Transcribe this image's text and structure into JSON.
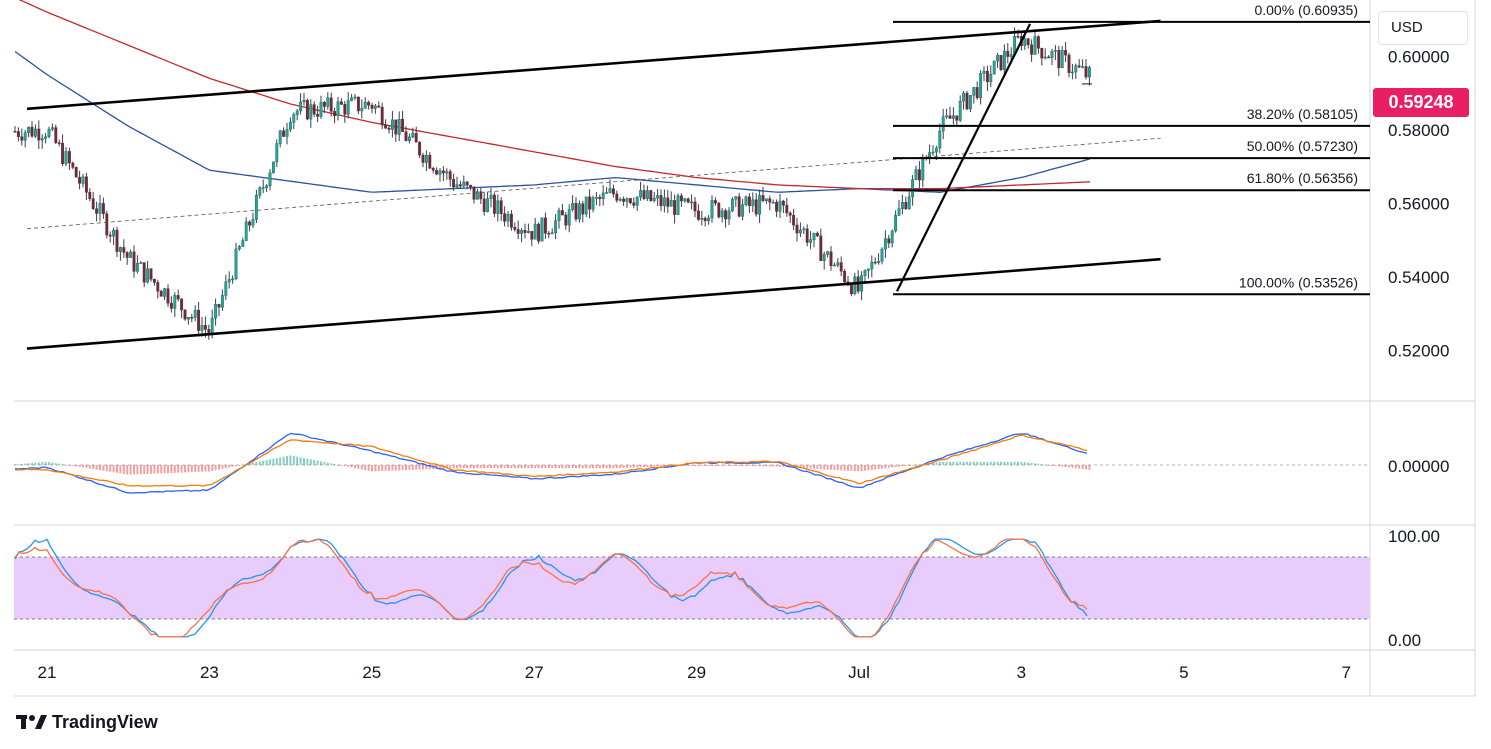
{
  "currency": "USD",
  "last_price": "0.59248",
  "colors": {
    "up": "#26a69a",
    "down": "#ef5350",
    "candle_body": "#6b2c3a",
    "ma_fast": "#2952a3",
    "ma_slow": "#c62828",
    "macd": "#2962ff",
    "signal": "#f57c00",
    "stoch_k": "#2196f3",
    "stoch_d": "#ff7043",
    "stoch_band": "#e8ccfb",
    "last_price": "#e91e63"
  },
  "chart_data": [
    {
      "type": "candlestick",
      "panel": "price",
      "ylim": [
        0.5065,
        0.6153
      ],
      "x_ticks": [
        "21",
        "23",
        "25",
        "27",
        "29",
        "Jul",
        "3",
        "5",
        "7"
      ],
      "y_ticks": [
        "0.60000",
        "0.58000",
        "0.56000",
        "0.54000",
        "0.52000"
      ],
      "approx_path_dates": [
        "Jun 20",
        "Jun 21",
        "Jun 22",
        "Jun 23",
        "Jun 24",
        "Jun 25",
        "Jun 26",
        "Jun 27",
        "Jun 28",
        "Jun 29",
        "Jun 30",
        "Jul 1",
        "Jul 2",
        "Jul 3",
        "Jul 4"
      ],
      "approx_close_path": [
        0.579,
        0.58,
        0.545,
        0.525,
        0.585,
        0.587,
        0.566,
        0.552,
        0.563,
        0.558,
        0.56,
        0.536,
        0.58,
        0.605,
        0.5925
      ],
      "last_price": 0.59248,
      "fibonacci": [
        {
          "label": "0.00% (0.60935)",
          "price": 0.60935
        },
        {
          "label": "38.20% (0.58105)",
          "price": 0.58105
        },
        {
          "label": "50.00% (0.57230)",
          "price": 0.5723
        },
        {
          "label": "61.80% (0.56356)",
          "price": 0.56356
        },
        {
          "label": "100.00% (0.53526)",
          "price": 0.53526
        }
      ],
      "channel": {
        "upper": [
          {
            "date": "Jun 21",
            "price": 0.5857
          },
          {
            "date": "Jul 4",
            "price": 0.6096
          }
        ],
        "lower": [
          {
            "date": "Jun 21",
            "price": 0.5205
          },
          {
            "date": "Jul 4",
            "price": 0.5448
          }
        ],
        "midline": [
          {
            "date": "Jun 21",
            "price": 0.5531
          },
          {
            "date": "Jul 4",
            "price": 0.5777
          }
        ]
      },
      "moving_averages": [
        {
          "name": "MA fast",
          "path": [
            [
              0.611
            ],
            [
              0.595
            ],
            [
              0.581
            ],
            [
              0.569
            ],
            [
              0.566
            ],
            [
              0.563
            ],
            [
              0.564
            ],
            [
              0.565
            ],
            [
              0.567
            ],
            [
              0.565
            ],
            [
              0.563
            ],
            [
              0.564
            ],
            [
              0.563
            ],
            [
              0.567
            ],
            [
              0.573
            ]
          ]
        },
        {
          "name": "MA slow",
          "path": [
            [
              0.622
            ],
            [
              0.612
            ],
            [
              0.603
            ],
            [
              0.594
            ],
            [
              0.587
            ],
            [
              0.582
            ],
            [
              0.578
            ],
            [
              0.574
            ],
            [
              0.57
            ],
            [
              0.567
            ],
            [
              0.565
            ],
            [
              0.564
            ],
            [
              0.564
            ],
            [
              0.565
            ],
            [
              0.566
            ]
          ]
        }
      ]
    },
    {
      "type": "line",
      "panel": "macd",
      "y_ticks": [
        "0.00000"
      ],
      "zero_line": 0.0,
      "approx_path_dates": [
        "Jun 20",
        "Jun 21",
        "Jun 22",
        "Jun 23",
        "Jun 24",
        "Jun 25",
        "Jun 26",
        "Jun 27",
        "Jun 28",
        "Jun 29",
        "Jun 30",
        "Jul 1",
        "Jul 2",
        "Jul 3",
        "Jul 4"
      ],
      "macd": [
        -0.003,
        -0.001,
        -0.012,
        -0.011,
        0.014,
        0.006,
        -0.003,
        -0.006,
        -0.004,
        0.001,
        0.001,
        -0.01,
        0.003,
        0.014,
        0.003
      ],
      "signal": [
        -0.002,
        -0.002,
        -0.009,
        -0.009,
        0.011,
        0.008,
        -0.002,
        -0.005,
        -0.003,
        0.001,
        0.0015,
        -0.008,
        0.002,
        0.013,
        0.005
      ]
    },
    {
      "type": "line",
      "panel": "stochastic",
      "ylim": [
        0,
        100
      ],
      "y_ticks": [
        "100.00",
        "0.00"
      ],
      "band": [
        20,
        80
      ],
      "approx_path_dates": [
        "Jun 20",
        "Jun 21",
        "Jun 22",
        "Jun 23",
        "Jun 24",
        "Jun 25",
        "Jun 26",
        "Jun 27",
        "Jun 28",
        "Jun 29",
        "Jun 30",
        "Jul 1",
        "Jul 2",
        "Jul 3",
        "Jul 4"
      ],
      "k": [
        30,
        85,
        15,
        20,
        90,
        60,
        25,
        60,
        80,
        50,
        35,
        10,
        90,
        85,
        35
      ],
      "d": [
        32,
        80,
        18,
        22,
        86,
        62,
        28,
        58,
        78,
        52,
        38,
        12,
        86,
        84,
        40
      ]
    }
  ],
  "brand": {
    "name": "TradingView",
    "logo_text": "17"
  }
}
